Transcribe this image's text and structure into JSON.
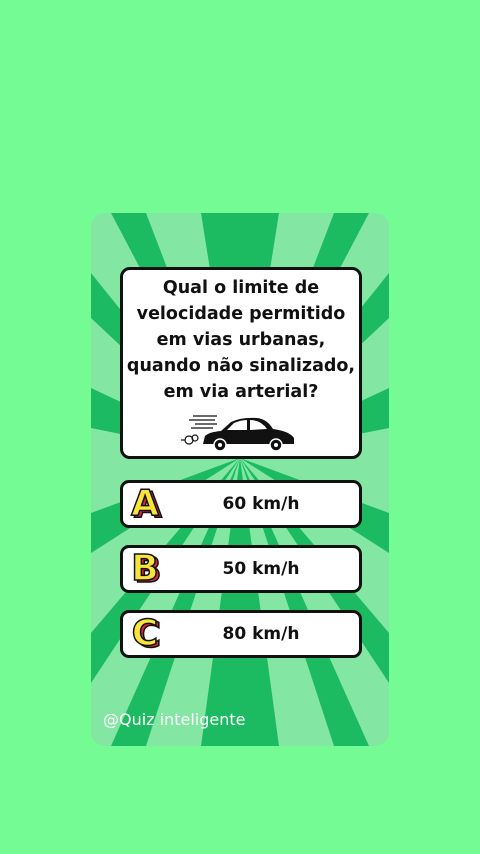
{
  "quiz": {
    "question": "Qual o limite de velocidade permitido em vias urbanas, quando não sinalizado, em via arterial?",
    "options": [
      {
        "letter": "A",
        "label": "60 km/h"
      },
      {
        "letter": "B",
        "label": "50 km/h"
      },
      {
        "letter": "C",
        "label": "80 km/h"
      }
    ]
  },
  "watermark": "@Quiz inteligente",
  "colors": {
    "background": "#74fb94",
    "card_light": "#83e6a3",
    "card_rays": "#1dbb61",
    "badge_fill": "#f8e53a",
    "badge_shadow": "#d9253b"
  },
  "icons": [
    "car-icon"
  ]
}
